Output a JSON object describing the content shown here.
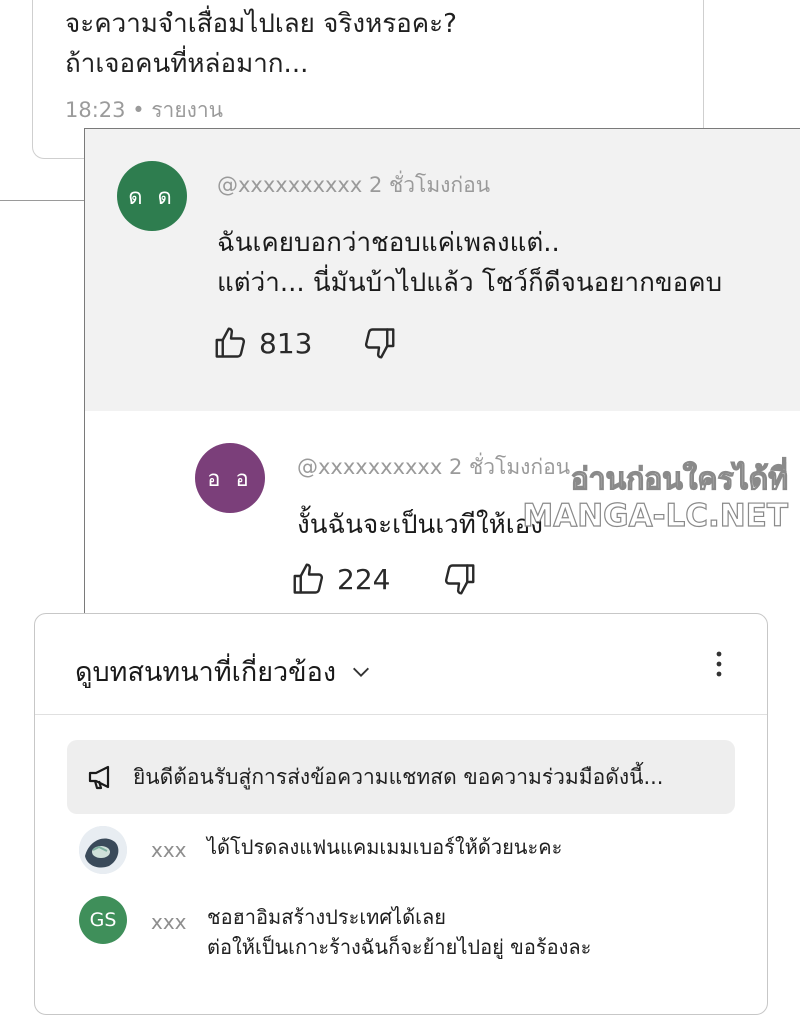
{
  "top_comment": {
    "line1": "จะความจำเสื่อมไปเลย จริงหรอคะ?",
    "line2": "ถ้าเจอคนที่หล่อมาก...",
    "meta": "18:23 • รายงาน"
  },
  "comment": {
    "avatar_initials": "ด ด",
    "avatar_color": "#2e7d4f",
    "handle": "@xxxxxxxxxx 2 ชั่วโมงก่อน",
    "line1": "ฉันเคยบอกว่าชอบแค่เพลงแต่..",
    "line2": "แต่ว่า... นี่มันบ้าไปแล้ว โชว์ก็ดีจนอยากขอคบ",
    "likes": "813"
  },
  "reply": {
    "avatar_initials": "อ อ",
    "avatar_color": "#7b3f7a",
    "handle": "@xxxxxxxxxx 2 ชั่วโมงก่อน",
    "text": "งั้นฉันจะเป็นเวทีให้เอง",
    "likes": "224"
  },
  "watermark": {
    "line1": "อ่านก่อนใครได้ที่",
    "line2": "MANGA-LC.NET"
  },
  "live_chat": {
    "title": "ดูบทสนทนาที่เกี่ยวข้อง",
    "banner": "ยินดีต้อนรับสู่การส่งข้อความแชทสด ขอความร่วมมือดังนี้...",
    "messages": [
      {
        "name": "xxx",
        "lines": [
          "ได้โปรดลงแฟนแคมเมมเบอร์ให้ด้วยนะคะ"
        ],
        "avatar": "image"
      },
      {
        "name": "xxx",
        "lines": [
          "ชอฮาอิมสร้างประเทศได้เลย",
          "ต่อให้เป็นเกาะร้างฉันก็จะย้ายไปอยู่ ขอร้องละ"
        ],
        "avatar_initials": "GS",
        "avatar_color": "#3f8f5a"
      }
    ]
  }
}
